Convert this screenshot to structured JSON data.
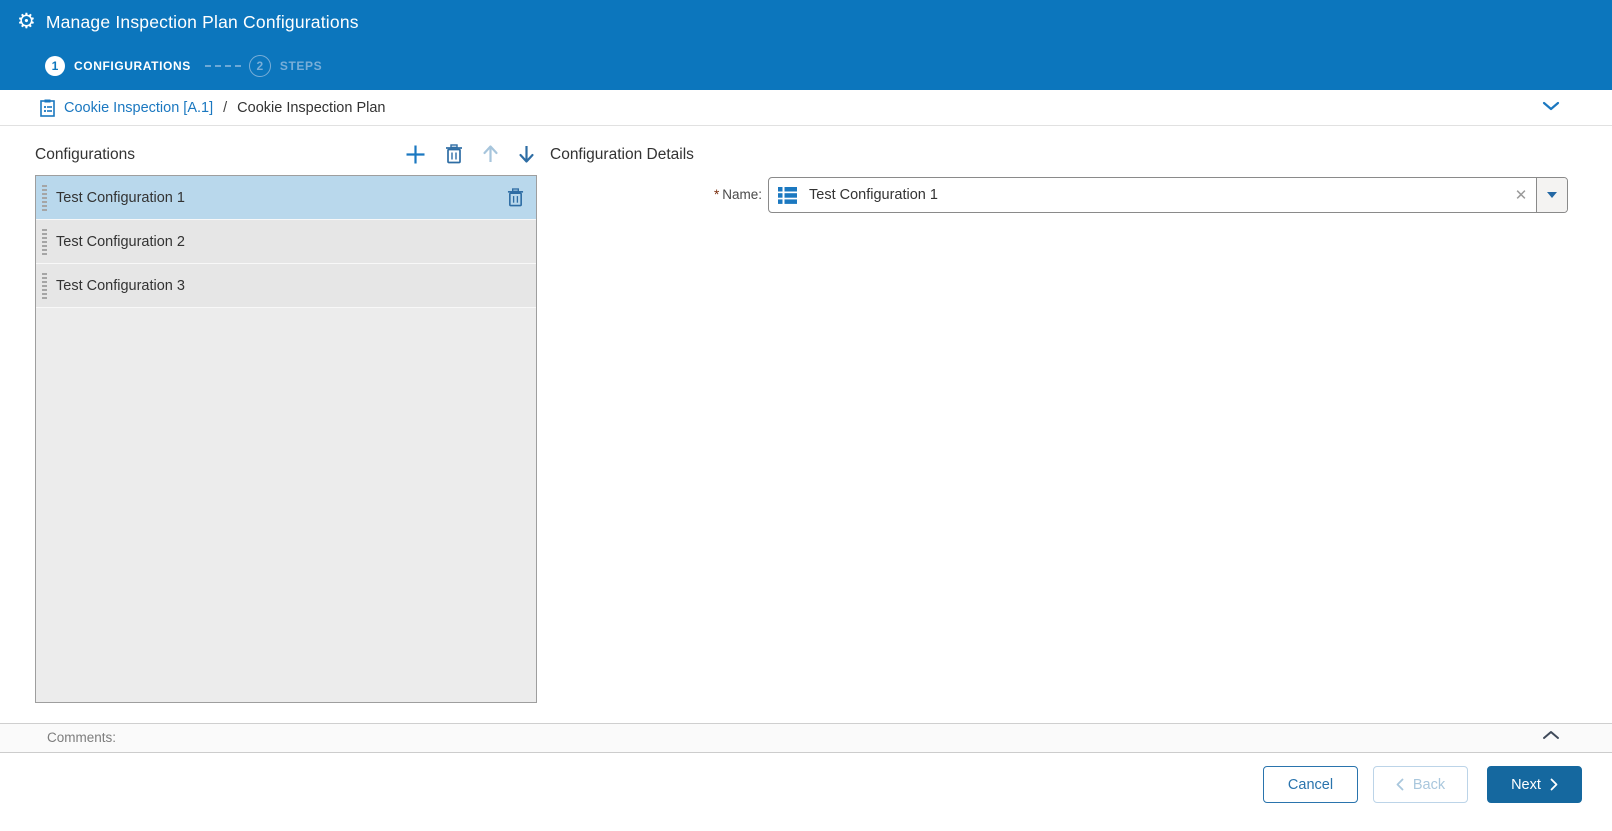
{
  "window": {
    "title": "Manage Inspection Plan Configurations"
  },
  "wizard": {
    "steps": [
      {
        "number": "1",
        "label": "CONFIGURATIONS",
        "state": "active"
      },
      {
        "number": "2",
        "label": "STEPS",
        "state": "inactive"
      }
    ]
  },
  "breadcrumb": {
    "parent": "Cookie Inspection [A.1]",
    "separator": "/",
    "current": "Cookie Inspection Plan"
  },
  "configurations": {
    "title": "Configurations",
    "selected_index": 0,
    "items": [
      {
        "label": "Test Configuration 1"
      },
      {
        "label": "Test Configuration 2"
      },
      {
        "label": "Test Configuration 3"
      }
    ]
  },
  "details": {
    "title": "Configuration Details",
    "name_field": {
      "required_marker": "*",
      "label": "Name:",
      "value": "Test Configuration 1"
    }
  },
  "comments": {
    "label": "Comments:"
  },
  "footer": {
    "cancel": "Cancel",
    "back": "Back",
    "next": "Next"
  },
  "icons": {
    "gear": "⚙",
    "clear": "✕"
  },
  "colors": {
    "header_bg": "#0c76bd",
    "accent_blue": "#1b78c0",
    "selected_row_bg": "#b9d8ec",
    "next_button_bg": "#15689f",
    "required_marker": "#7a2e0e"
  }
}
